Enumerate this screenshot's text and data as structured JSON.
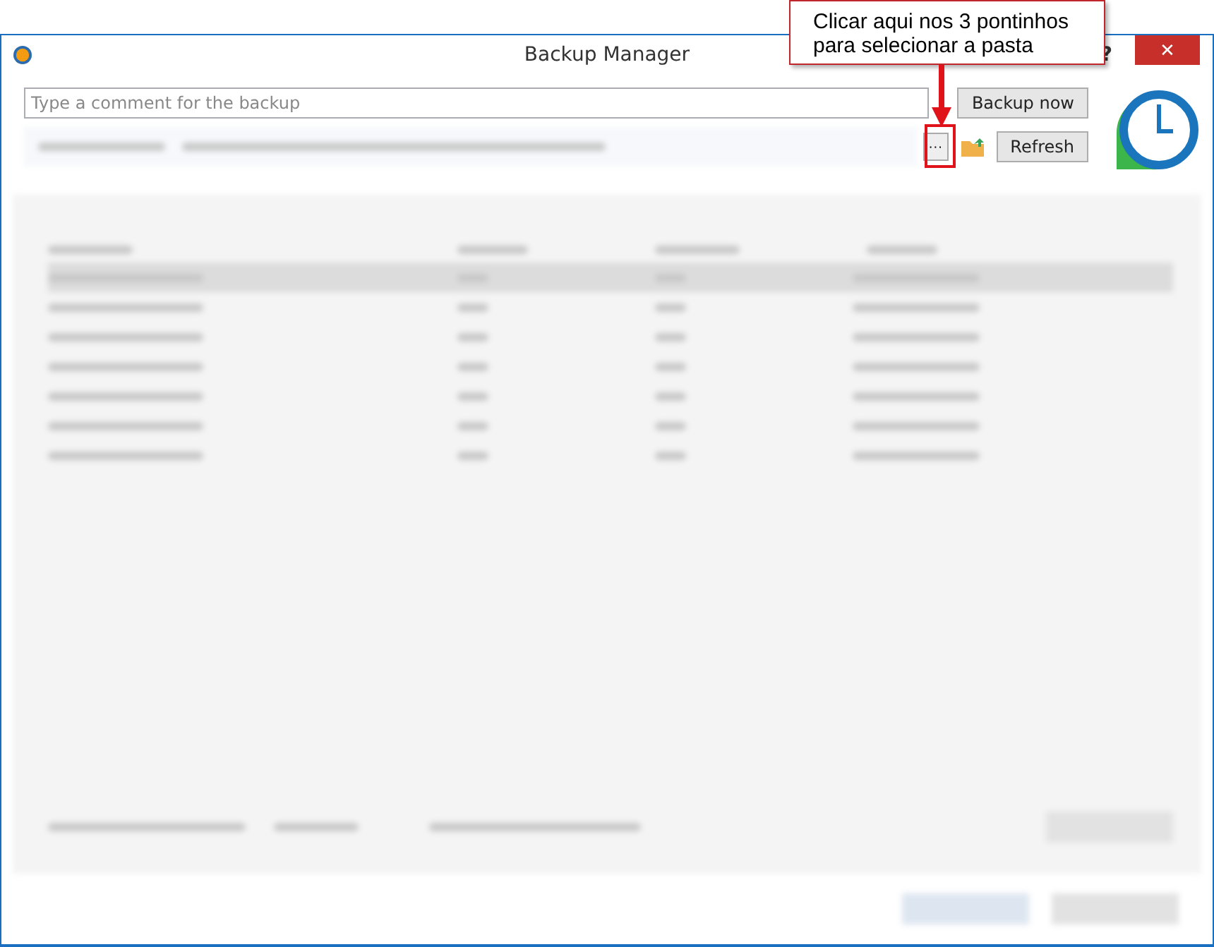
{
  "window": {
    "title": "Backup Manager",
    "help": "?",
    "close": "✕"
  },
  "comment_field": {
    "placeholder": "Type a comment for the backup"
  },
  "buttons": [
    {
      "kind": "backup",
      "label": "Backup now"
    },
    {
      "kind": "browse",
      "label": "···"
    },
    {
      "kind": "refresh",
      "label": "Refresh"
    }
  ],
  "callout": {
    "lines": [
      "Clicar aqui nos 3 pontinhos",
      "para selecionar a pasta"
    ]
  }
}
